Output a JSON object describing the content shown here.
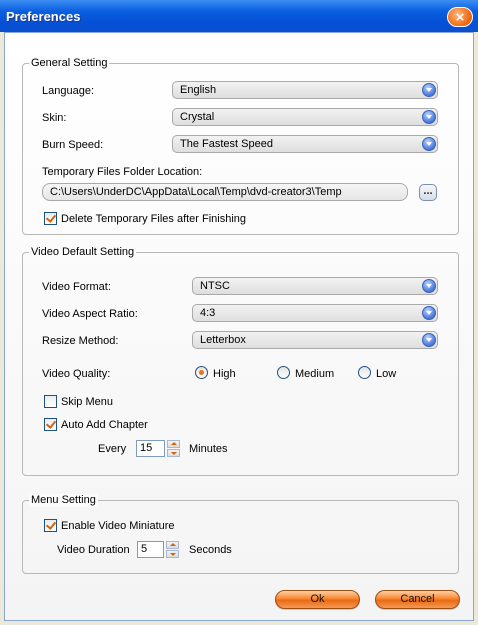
{
  "window": {
    "title": "Preferences",
    "close_label": "×"
  },
  "general": {
    "title": "General Setting",
    "language_label": "Language:",
    "language_value": "English",
    "skin_label": "Skin:",
    "skin_value": "Crystal",
    "burn_speed_label": "Burn Speed:",
    "burn_speed_value": "The Fastest Speed",
    "temp_folder_label": "Temporary Files Folder Location:",
    "temp_folder_value": "C:\\Users\\UnderDC\\AppData\\Local\\Temp\\dvd-creator3\\Temp",
    "browse_label": "...",
    "delete_temp_label": "Delete Temporary Files after Finishing",
    "delete_temp_checked": true
  },
  "video": {
    "title": "Video Default Setting",
    "format_label": "Video Format:",
    "format_value": "NTSC",
    "aspect_label": "Video Aspect Ratio:",
    "aspect_value": "4:3",
    "resize_label": "Resize Method:",
    "resize_value": "Letterbox",
    "quality_label": "Video Quality:",
    "quality_options": [
      "High",
      "Medium",
      "Low"
    ],
    "quality_selected": "High",
    "skip_menu_label": "Skip Menu",
    "skip_menu_checked": false,
    "auto_chapter_label": "Auto Add Chapter",
    "auto_chapter_checked": true,
    "every_label": "Every",
    "every_value": "15",
    "minutes_label": "Minutes"
  },
  "menu": {
    "title": "Menu Setting",
    "miniature_label": "Enable Video Miniature",
    "miniature_checked": true,
    "duration_label": "Video Duration",
    "duration_value": "5",
    "seconds_label": "Seconds"
  },
  "buttons": {
    "ok_label": "Ok",
    "cancel_label": "Cancel"
  },
  "colors": {
    "titlebar": "#0550d6",
    "accent_orange": "#ea6a12",
    "dropdown_blue": "#4a77d8"
  }
}
